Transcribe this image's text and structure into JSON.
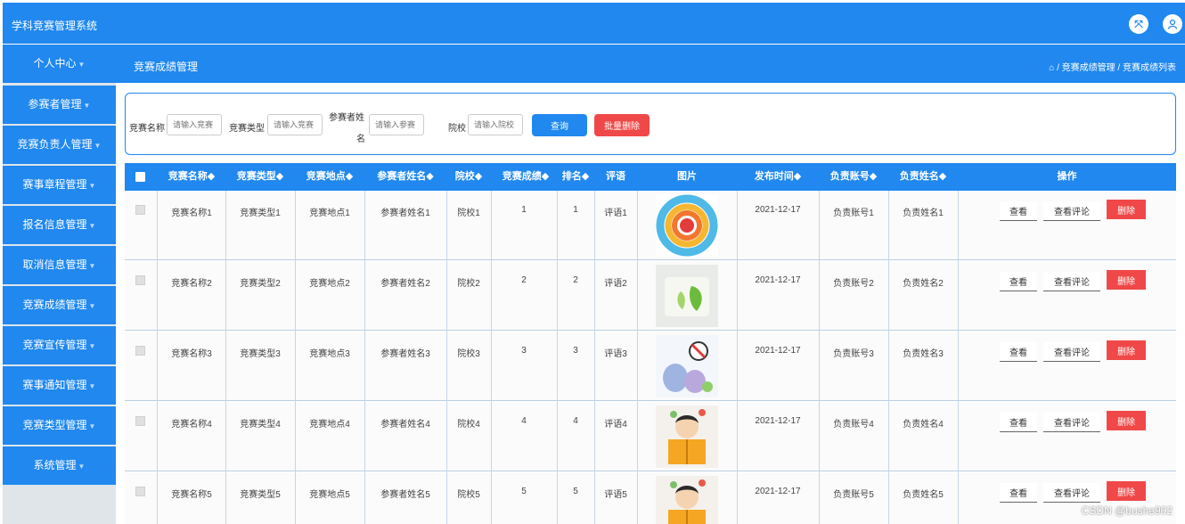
{
  "app": {
    "title": "学科竞赛管理系统"
  },
  "header": {
    "page_title": "竞赛成绩管理",
    "breadcrumb": "⌂ / 竞赛成绩管理 / 竞赛成绩列表"
  },
  "icons": {
    "expand": "expand-icon",
    "user": "user-icon",
    "home": "home-icon"
  },
  "sidebar": {
    "items": [
      {
        "label": "个人中心"
      },
      {
        "label": "参赛者管理"
      },
      {
        "label": "竞赛负责人管理"
      },
      {
        "label": "赛事章程管理"
      },
      {
        "label": "报名信息管理"
      },
      {
        "label": "取消信息管理"
      },
      {
        "label": "竞赛成绩管理"
      },
      {
        "label": "竞赛宣传管理"
      },
      {
        "label": "赛事通知管理"
      },
      {
        "label": "竞赛类型管理"
      },
      {
        "label": "系统管理"
      }
    ]
  },
  "search": {
    "name_label": "竞赛名称",
    "name_placeholder": "请输入竞赛",
    "type_label": "竞赛类型",
    "type_placeholder": "请输入竞赛",
    "player_label_1": "参赛者姓",
    "player_label_2": "名",
    "player_placeholder": "请输入参赛",
    "school_label": "院校",
    "school_placeholder": "请输入院校",
    "query_label": "查询",
    "batch_delete_label": "批量删除"
  },
  "table": {
    "headers": [
      "竞赛名称◆",
      "竞赛类型◆",
      "竞赛地点◆",
      "参赛者姓名◆",
      "院校◆",
      "竞赛成绩◆",
      "排名◆",
      "评语",
      "图片",
      "发布时间◆",
      "负责账号◆",
      "负责姓名◆",
      "操作"
    ],
    "actions": {
      "view": "查看",
      "view_comment": "查看评论",
      "delete": "删除"
    },
    "rows": [
      {
        "name": "竞赛名称1",
        "type": "竞赛类型1",
        "place": "竞赛地点1",
        "player": "参赛者姓名1",
        "school": "院校1",
        "score": "1",
        "rank": "1",
        "comment": "评语1",
        "time": "2021-12-17",
        "account": "负责账号1",
        "leader": "负责姓名1",
        "image": "donut-chart-image"
      },
      {
        "name": "竞赛名称2",
        "type": "竞赛类型2",
        "place": "竞赛地点2",
        "player": "参赛者姓名2",
        "school": "院校2",
        "score": "2",
        "rank": "2",
        "comment": "评语2",
        "time": "2021-12-17",
        "account": "负责账号2",
        "leader": "负责姓名2",
        "image": "leaf-card-image"
      },
      {
        "name": "竞赛名称3",
        "type": "竞赛类型3",
        "place": "竞赛地点3",
        "player": "参赛者姓名3",
        "school": "院校3",
        "score": "3",
        "rank": "3",
        "comment": "评语3",
        "time": "2021-12-17",
        "account": "负责账号3",
        "leader": "负责姓名3",
        "image": "virus-cartoon-image"
      },
      {
        "name": "竞赛名称4",
        "type": "竞赛类型4",
        "place": "竞赛地点4",
        "player": "参赛者姓名4",
        "school": "院校4",
        "score": "4",
        "rank": "4",
        "comment": "评语4",
        "time": "2021-12-17",
        "account": "负责账号4",
        "leader": "负责姓名4",
        "image": "reading-girl-image"
      },
      {
        "name": "竞赛名称5",
        "type": "竞赛类型5",
        "place": "竞赛地点5",
        "player": "参赛者姓名5",
        "school": "院校5",
        "score": "5",
        "rank": "5",
        "comment": "评语5",
        "time": "2021-12-17",
        "account": "负责账号5",
        "leader": "负责姓名5",
        "image": "reading-girl-image"
      }
    ]
  },
  "watermark": "CSDN @bushe902",
  "colors": {
    "primary": "#2088ef",
    "danger": "#f04848",
    "sidebar_bg": "#dfe5e9"
  }
}
